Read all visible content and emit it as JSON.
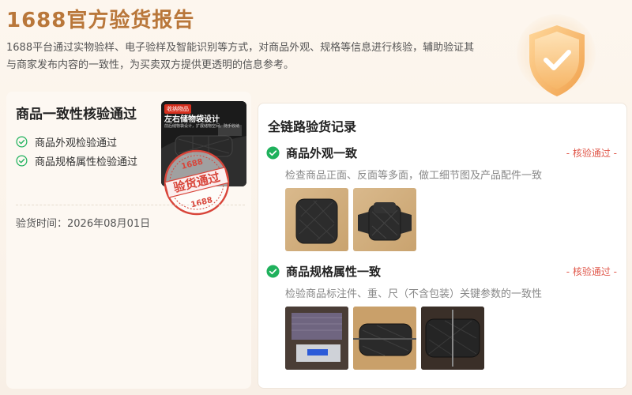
{
  "header": {
    "title": "1688官方验货报告",
    "desc_line1": "1688平台通过实物验样、电子验样及智能识别等方式，对商品外观、规格等信息进行核验，辅助验证其",
    "desc_line2": "与商家发布内容的一致性，为买卖双方提供更透明的信息参考。"
  },
  "left": {
    "title": "商品一致性核验通过",
    "checks": [
      "商品外观检验通过",
      "商品规格属性检验通过"
    ],
    "inspect_time": "验货时间：2026年08月01日",
    "thumb_tag": "收纳物品",
    "thumb_headline": "左右储物袋设计",
    "thumb_sub": "前后储物袋设计，扩展储物空间，随手收纳",
    "stamp_top": "1688",
    "stamp_main": "验货通过",
    "stamp_bottom": "1688"
  },
  "right": {
    "title": "全链路验货记录",
    "sections": [
      {
        "title": "商品外观一致",
        "status": "- 核验通过 -",
        "desc": "检查商品正面、反面等多面，做工细节图及产品配件一致"
      },
      {
        "title": "商品规格属性一致",
        "status": "- 核验通过 -",
        "desc": "检验商品标注件、重、尺（不含包装）关键参数的一致性"
      }
    ]
  },
  "colors": {
    "brand": "#b9773a",
    "check_green": "#1fb15c",
    "status_red": "#e0584b",
    "stamp_red": "#d8453a"
  },
  "icons": [
    "shield-check-icon",
    "check-circle-icon",
    "check-circle-filled-icon"
  ]
}
